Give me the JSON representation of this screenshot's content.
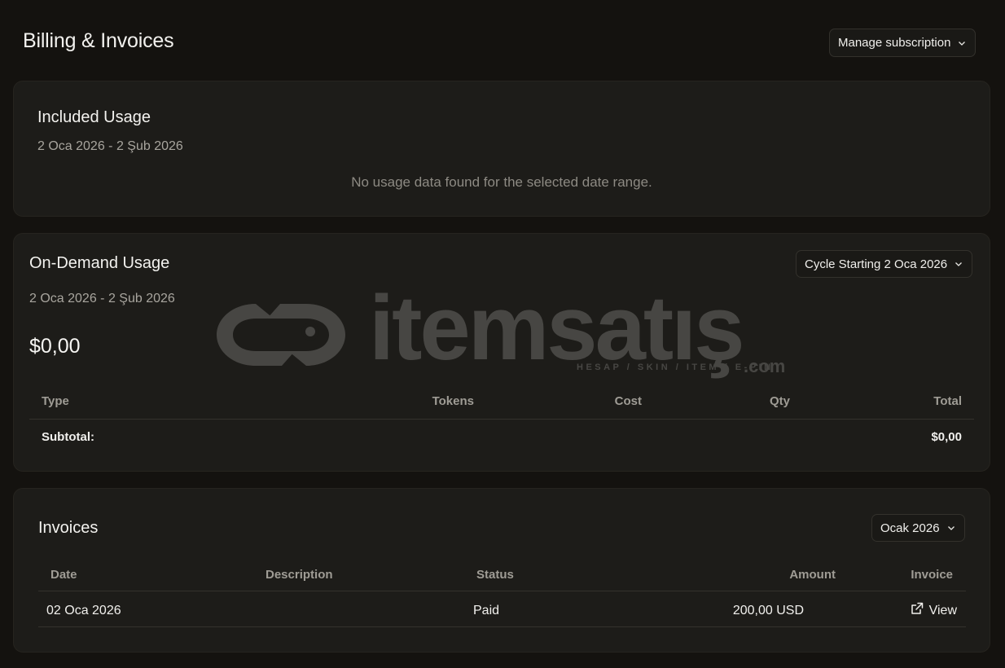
{
  "header": {
    "title": "Billing & Invoices",
    "manage_label": "Manage subscription"
  },
  "included_usage": {
    "title": "Included Usage",
    "date_range": "2 Oca 2026 - 2 Şub 2026",
    "empty_message": "No usage data found for the selected date range."
  },
  "on_demand": {
    "title": "On-Demand Usage",
    "cycle_label": "Cycle Starting 2 Oca 2026",
    "date_range": "2 Oca 2026 - 2 Şub 2026",
    "amount": "$0,00",
    "columns": [
      "Type",
      "Tokens",
      "Cost",
      "Qty",
      "Total"
    ],
    "subtotal_label": "Subtotal:",
    "subtotal_value": "$0,00"
  },
  "invoices": {
    "title": "Invoices",
    "month_label": "Ocak 2026",
    "columns": [
      "Date",
      "Description",
      "Status",
      "Amount",
      "Invoice"
    ],
    "rows": [
      {
        "date": "02 Oca 2026",
        "description": "",
        "status": "Paid",
        "amount": "200,00 USD",
        "invoice": "View"
      }
    ]
  },
  "watermark": {
    "brand": "itemsatış",
    "tagline": "HESAP / SKIN / ITEM / E-PIN",
    "suffix": ".com"
  },
  "icons": {
    "dropdown": "chevron-down-icon",
    "external": "external-link-icon",
    "logo": "itemsatis-logo-icon"
  }
}
